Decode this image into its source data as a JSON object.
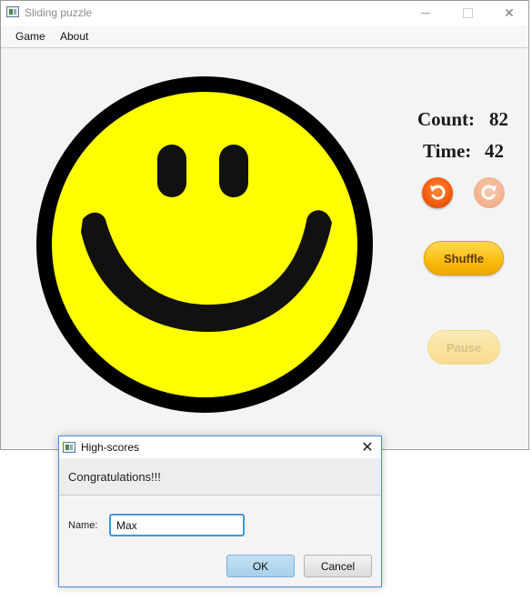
{
  "window": {
    "title": "Sliding puzzle",
    "controls": {
      "minimize": "minimize-icon",
      "maximize": "maximize-icon",
      "close": "close-icon"
    }
  },
  "menu": {
    "game": "Game",
    "about": "About"
  },
  "stats": {
    "count_label": "Count:",
    "count_value": "82",
    "time_label": "Time:",
    "time_value": "42"
  },
  "buttons": {
    "undo_icon": "undo-icon",
    "redo_icon": "redo-icon",
    "shuffle": "Shuffle",
    "pause": "Pause"
  },
  "dialog": {
    "title": "High-scores",
    "header": "Congratulations!!!",
    "name_label": "Name:",
    "name_value": "Max",
    "ok": "OK",
    "cancel": "Cancel"
  },
  "colors": {
    "smiley_fill": "#ffff00",
    "smiley_outline": "#000000",
    "shuffle": "#fbbf10",
    "undo": "#f25a0c",
    "dialog_border": "#4a90d9"
  }
}
